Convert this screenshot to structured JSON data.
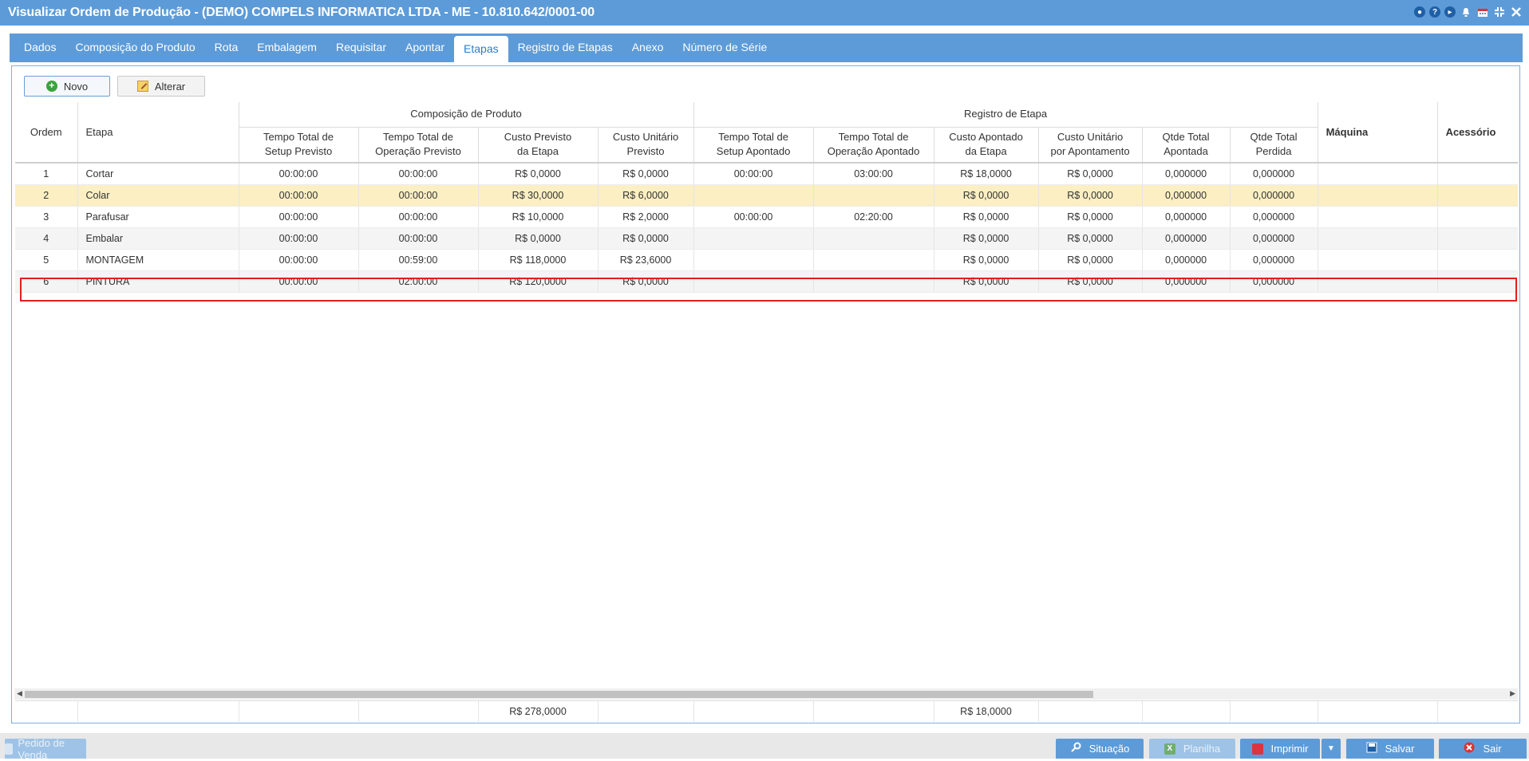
{
  "window": {
    "title": "Visualizar Ordem de Produção - (DEMO) COMPELS INFORMATICA LTDA - ME - 10.810.642/0001-00",
    "icons": [
      "chat-icon",
      "help-icon",
      "play-icon",
      "bell-icon",
      "calendar-icon",
      "collapse-icon",
      "close-icon"
    ]
  },
  "tabs": [
    {
      "label": "Dados",
      "active": false
    },
    {
      "label": "Composição do Produto",
      "active": false
    },
    {
      "label": "Rota",
      "active": false
    },
    {
      "label": "Embalagem",
      "active": false
    },
    {
      "label": "Requisitar",
      "active": false
    },
    {
      "label": "Apontar",
      "active": false
    },
    {
      "label": "Etapas",
      "active": true
    },
    {
      "label": "Registro de Etapas",
      "active": false
    },
    {
      "label": "Anexo",
      "active": false
    },
    {
      "label": "Número de Série",
      "active": false
    }
  ],
  "toolbar": {
    "novo_label": "Novo",
    "alterar_label": "Alterar"
  },
  "grid": {
    "group_headers": {
      "composicao": "Composição de Produto",
      "registro": "Registro de Etapa"
    },
    "columns": {
      "ordem": "Ordem",
      "etapa": "Etapa",
      "setup_previsto": [
        "Tempo Total de",
        "Setup Previsto"
      ],
      "operacao_previsto": [
        "Tempo Total de",
        "Operação Previsto"
      ],
      "custo_previsto": [
        "Custo Previsto",
        "da Etapa"
      ],
      "custo_unit_previsto": [
        "Custo Unitário",
        "Previsto"
      ],
      "setup_apontado": [
        "Tempo Total de",
        "Setup Apontado"
      ],
      "operacao_apontado": [
        "Tempo Total de",
        "Operação Apontado"
      ],
      "custo_apontado": [
        "Custo Apontado",
        "da Etapa"
      ],
      "custo_unit_apont": [
        "Custo Unitário",
        "por Apontamento"
      ],
      "qtde_apontada": [
        "Qtde Total",
        "Apontada"
      ],
      "qtde_perdida": [
        "Qtde Total",
        "Perdida"
      ],
      "maquina": "Máquina",
      "acessorio": "Acessório"
    },
    "rows": [
      {
        "ordem": "1",
        "etapa": "Cortar",
        "setup_prev": "00:00:00",
        "oper_prev": "00:00:00",
        "custo_prev": "R$ 0,0000",
        "custo_unit_prev": "R$ 0,0000",
        "setup_apont": "00:00:00",
        "oper_apont": "03:00:00",
        "custo_apont": "R$ 18,0000",
        "custo_unit_apont": "R$ 0,0000",
        "qtde_apont": "0,000000",
        "qtde_perd": "0,000000",
        "maquina": "",
        "acessorio": ""
      },
      {
        "ordem": "2",
        "etapa": "Colar",
        "setup_prev": "00:00:00",
        "oper_prev": "00:00:00",
        "custo_prev": "R$ 30,0000",
        "custo_unit_prev": "R$ 6,0000",
        "setup_apont": "",
        "oper_apont": "",
        "custo_apont": "R$ 0,0000",
        "custo_unit_apont": "R$ 0,0000",
        "qtde_apont": "0,000000",
        "qtde_perd": "0,000000",
        "maquina": "",
        "acessorio": "",
        "selected": true
      },
      {
        "ordem": "3",
        "etapa": "Parafusar",
        "setup_prev": "00:00:00",
        "oper_prev": "00:00:00",
        "custo_prev": "R$ 10,0000",
        "custo_unit_prev": "R$ 2,0000",
        "setup_apont": "00:00:00",
        "oper_apont": "02:20:00",
        "custo_apont": "R$ 0,0000",
        "custo_unit_apont": "R$ 0,0000",
        "qtde_apont": "0,000000",
        "qtde_perd": "0,000000",
        "maquina": "",
        "acessorio": ""
      },
      {
        "ordem": "4",
        "etapa": "Embalar",
        "setup_prev": "00:00:00",
        "oper_prev": "00:00:00",
        "custo_prev": "R$ 0,0000",
        "custo_unit_prev": "R$ 0,0000",
        "setup_apont": "",
        "oper_apont": "",
        "custo_apont": "R$ 0,0000",
        "custo_unit_apont": "R$ 0,0000",
        "qtde_apont": "0,000000",
        "qtde_perd": "0,000000",
        "maquina": "",
        "acessorio": ""
      },
      {
        "ordem": "5",
        "etapa": "MONTAGEM",
        "setup_prev": "00:00:00",
        "oper_prev": "00:59:00",
        "custo_prev": "R$ 118,0000",
        "custo_unit_prev": "R$ 23,6000",
        "setup_apont": "",
        "oper_apont": "",
        "custo_apont": "R$ 0,0000",
        "custo_unit_apont": "R$ 0,0000",
        "qtde_apont": "0,000000",
        "qtde_perd": "0,000000",
        "maquina": "",
        "acessorio": ""
      },
      {
        "ordem": "6",
        "etapa": "PINTURA",
        "setup_prev": "00:00:00",
        "oper_prev": "02:00:00",
        "custo_prev": "R$ 120,0000",
        "custo_unit_prev": "R$ 0,0000",
        "setup_apont": "",
        "oper_apont": "",
        "custo_apont": "R$ 0,0000",
        "custo_unit_apont": "R$ 0,0000",
        "qtde_apont": "0,000000",
        "qtde_perd": "0,000000",
        "maquina": "",
        "acessorio": ""
      }
    ],
    "totals": {
      "custo_previsto": "R$ 278,0000",
      "custo_apontado": "R$ 18,0000"
    }
  },
  "bottom_bar": {
    "pedido_label": "Pedido de Venda",
    "situacao_label": "Situação",
    "planilha_label": "Planilha",
    "imprimir_label": "Imprimir",
    "salvar_label": "Salvar",
    "sair_label": "Sair"
  }
}
